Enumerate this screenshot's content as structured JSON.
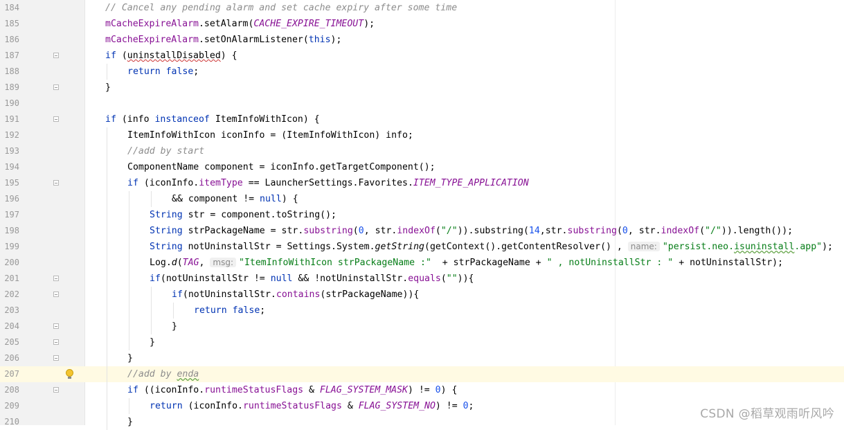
{
  "editor": {
    "lines": [
      {
        "num": "184",
        "indent": 1,
        "tokens": [
          {
            "t": "// Cancel any pending alarm and set cache expiry after some time",
            "k": "comment"
          }
        ]
      },
      {
        "num": "185",
        "indent": 1,
        "tokens": [
          {
            "t": "mCacheExpireAlarm",
            "k": "field"
          },
          {
            "t": ".setAlarm(",
            "k": "plain"
          },
          {
            "t": "CACHE_EXPIRE_TIMEOUT",
            "k": "static"
          },
          {
            "t": ");",
            "k": "plain"
          }
        ]
      },
      {
        "num": "186",
        "indent": 1,
        "tokens": [
          {
            "t": "mCacheExpireAlarm",
            "k": "field"
          },
          {
            "t": ".setOnAlarmListener(",
            "k": "plain"
          },
          {
            "t": "this",
            "k": "keyword"
          },
          {
            "t": ");",
            "k": "plain"
          }
        ]
      },
      {
        "num": "187",
        "indent": 1,
        "fold": true,
        "tokens": [
          {
            "t": "if",
            "k": "keyword"
          },
          {
            "t": " (",
            "k": "plain"
          },
          {
            "t": "uninstallDisabled",
            "k": "typo"
          },
          {
            "t": ") {",
            "k": "plain"
          }
        ]
      },
      {
        "num": "188",
        "indent": 2,
        "tokens": [
          {
            "t": "return",
            "k": "keyword"
          },
          {
            "t": " ",
            "k": "plain"
          },
          {
            "t": "false",
            "k": "keyword"
          },
          {
            "t": ";",
            "k": "plain"
          }
        ]
      },
      {
        "num": "189",
        "indent": 1,
        "fold": true,
        "tokens": [
          {
            "t": "}",
            "k": "plain"
          }
        ]
      },
      {
        "num": "190",
        "indent": 0,
        "tokens": []
      },
      {
        "num": "191",
        "indent": 1,
        "fold": true,
        "tokens": [
          {
            "t": "if",
            "k": "keyword"
          },
          {
            "t": " (info ",
            "k": "plain"
          },
          {
            "t": "instanceof",
            "k": "keyword"
          },
          {
            "t": " ItemInfoWithIcon) {",
            "k": "plain"
          }
        ]
      },
      {
        "num": "192",
        "indent": 2,
        "tokens": [
          {
            "t": "ItemInfoWithIcon iconInfo = (ItemInfoWithIcon) info;",
            "k": "plain"
          }
        ]
      },
      {
        "num": "193",
        "indent": 2,
        "tokens": [
          {
            "t": "//add by start",
            "k": "comment"
          }
        ]
      },
      {
        "num": "194",
        "indent": 2,
        "tokens": [
          {
            "t": "ComponentName component = iconInfo.getTargetComponent();",
            "k": "plain"
          }
        ]
      },
      {
        "num": "195",
        "indent": 2,
        "fold": true,
        "tokens": [
          {
            "t": "if",
            "k": "keyword"
          },
          {
            "t": " (iconInfo.",
            "k": "plain"
          },
          {
            "t": "itemType",
            "k": "field"
          },
          {
            "t": " == LauncherSettings.Favorites.",
            "k": "plain"
          },
          {
            "t": "ITEM_TYPE_APPLICATION",
            "k": "static"
          }
        ]
      },
      {
        "num": "196",
        "indent": 4,
        "tokens": [
          {
            "t": "&& component != ",
            "k": "plain"
          },
          {
            "t": "null",
            "k": "keyword"
          },
          {
            "t": ") {",
            "k": "plain"
          }
        ]
      },
      {
        "num": "197",
        "indent": 3,
        "tokens": [
          {
            "t": "String",
            "k": "keyword"
          },
          {
            "t": " str = component.toString();",
            "k": "plain"
          }
        ]
      },
      {
        "num": "198",
        "indent": 3,
        "tokens": [
          {
            "t": "String",
            "k": "keyword"
          },
          {
            "t": " strPackageName = str.",
            "k": "plain"
          },
          {
            "t": "substring",
            "k": "field"
          },
          {
            "t": "(",
            "k": "plain"
          },
          {
            "t": "0",
            "k": "number"
          },
          {
            "t": ", str.",
            "k": "plain"
          },
          {
            "t": "indexOf",
            "k": "field"
          },
          {
            "t": "(",
            "k": "plain"
          },
          {
            "t": "\"/\"",
            "k": "string"
          },
          {
            "t": ")).substring(",
            "k": "plain"
          },
          {
            "t": "14",
            "k": "number"
          },
          {
            "t": ",str.",
            "k": "plain"
          },
          {
            "t": "substring",
            "k": "field"
          },
          {
            "t": "(",
            "k": "plain"
          },
          {
            "t": "0",
            "k": "number"
          },
          {
            "t": ", str.",
            "k": "plain"
          },
          {
            "t": "indexOf",
            "k": "field"
          },
          {
            "t": "(",
            "k": "plain"
          },
          {
            "t": "\"/\"",
            "k": "string"
          },
          {
            "t": ")).length());",
            "k": "plain"
          }
        ]
      },
      {
        "num": "199",
        "indent": 3,
        "tokens": [
          {
            "t": "String",
            "k": "keyword"
          },
          {
            "t": " notUninstallStr = Settings.System.",
            "k": "plain"
          },
          {
            "t": "getString",
            "k": "method_italic"
          },
          {
            "t": "(getContext().getContentResolver() , ",
            "k": "plain"
          },
          {
            "t": "name:",
            "k": "hint"
          },
          {
            "t": "\"persist.neo.",
            "k": "string"
          },
          {
            "t": "isuninstall",
            "k": "string_typo"
          },
          {
            "t": ".app\"",
            "k": "string"
          },
          {
            "t": ");",
            "k": "plain"
          }
        ]
      },
      {
        "num": "200",
        "indent": 3,
        "tokens": [
          {
            "t": "Log.",
            "k": "plain"
          },
          {
            "t": "d",
            "k": "method_italic"
          },
          {
            "t": "(",
            "k": "plain"
          },
          {
            "t": "TAG",
            "k": "static"
          },
          {
            "t": ", ",
            "k": "plain"
          },
          {
            "t": "msg:",
            "k": "hint"
          },
          {
            "t": "\"ItemInfoWithIcon strPackageName :\"",
            "k": "string"
          },
          {
            "t": "  + strPackageName + ",
            "k": "plain"
          },
          {
            "t": "\" , notUninstallStr : \"",
            "k": "string"
          },
          {
            "t": " + notUninstallStr);",
            "k": "plain"
          }
        ]
      },
      {
        "num": "201",
        "indent": 3,
        "fold": true,
        "tokens": [
          {
            "t": "if",
            "k": "keyword"
          },
          {
            "t": "(notUninstallStr != ",
            "k": "plain"
          },
          {
            "t": "null",
            "k": "keyword"
          },
          {
            "t": " && !notUninstallStr.",
            "k": "plain"
          },
          {
            "t": "equals",
            "k": "field"
          },
          {
            "t": "(",
            "k": "plain"
          },
          {
            "t": "\"\"",
            "k": "string"
          },
          {
            "t": ")){",
            "k": "plain"
          }
        ]
      },
      {
        "num": "202",
        "indent": 4,
        "fold": true,
        "tokens": [
          {
            "t": "if",
            "k": "keyword"
          },
          {
            "t": "(notUninstallStr.",
            "k": "plain"
          },
          {
            "t": "contains",
            "k": "field"
          },
          {
            "t": "(strPackageName)){",
            "k": "plain"
          }
        ]
      },
      {
        "num": "203",
        "indent": 5,
        "tokens": [
          {
            "t": "return",
            "k": "keyword"
          },
          {
            "t": " ",
            "k": "plain"
          },
          {
            "t": "false",
            "k": "keyword"
          },
          {
            "t": ";",
            "k": "plain"
          }
        ]
      },
      {
        "num": "204",
        "indent": 4,
        "fold": true,
        "tokens": [
          {
            "t": "}",
            "k": "plain"
          }
        ]
      },
      {
        "num": "205",
        "indent": 3,
        "fold": true,
        "tokens": [
          {
            "t": "}",
            "k": "plain"
          }
        ]
      },
      {
        "num": "206",
        "indent": 2,
        "fold": true,
        "tokens": [
          {
            "t": "}",
            "k": "plain"
          }
        ]
      },
      {
        "num": "207",
        "indent": 2,
        "current": true,
        "bulb": true,
        "tokens": [
          {
            "t": "//add by ",
            "k": "comment"
          },
          {
            "t": "enda",
            "k": "comment_typo"
          }
        ]
      },
      {
        "num": "208",
        "indent": 2,
        "fold": true,
        "tokens": [
          {
            "t": "if",
            "k": "keyword"
          },
          {
            "t": " ((iconInfo.",
            "k": "plain"
          },
          {
            "t": "runtimeStatusFlags",
            "k": "field"
          },
          {
            "t": " & ",
            "k": "plain"
          },
          {
            "t": "FLAG_SYSTEM_MASK",
            "k": "static"
          },
          {
            "t": ") != ",
            "k": "plain"
          },
          {
            "t": "0",
            "k": "number"
          },
          {
            "t": ") {",
            "k": "plain"
          }
        ]
      },
      {
        "num": "209",
        "indent": 3,
        "tokens": [
          {
            "t": "return",
            "k": "keyword"
          },
          {
            "t": " (iconInfo.",
            "k": "plain"
          },
          {
            "t": "runtimeStatusFlags",
            "k": "field"
          },
          {
            "t": " & ",
            "k": "plain"
          },
          {
            "t": "FLAG_SYSTEM_NO",
            "k": "static"
          },
          {
            "t": ") != ",
            "k": "plain"
          },
          {
            "t": "0",
            "k": "number"
          },
          {
            "t": ";",
            "k": "plain"
          }
        ]
      },
      {
        "num": "210",
        "indent": 2,
        "tokens": [
          {
            "t": "}",
            "k": "plain"
          }
        ]
      }
    ],
    "colors": {
      "keyword": "#0033b3",
      "field": "#871094",
      "string": "#067d17",
      "comment": "#8c8c8c",
      "number": "#1750eb",
      "gutter": "#f2f2f2",
      "current_line": "#fffae3"
    }
  },
  "watermark": "CSDN @稻草观雨听风吟"
}
